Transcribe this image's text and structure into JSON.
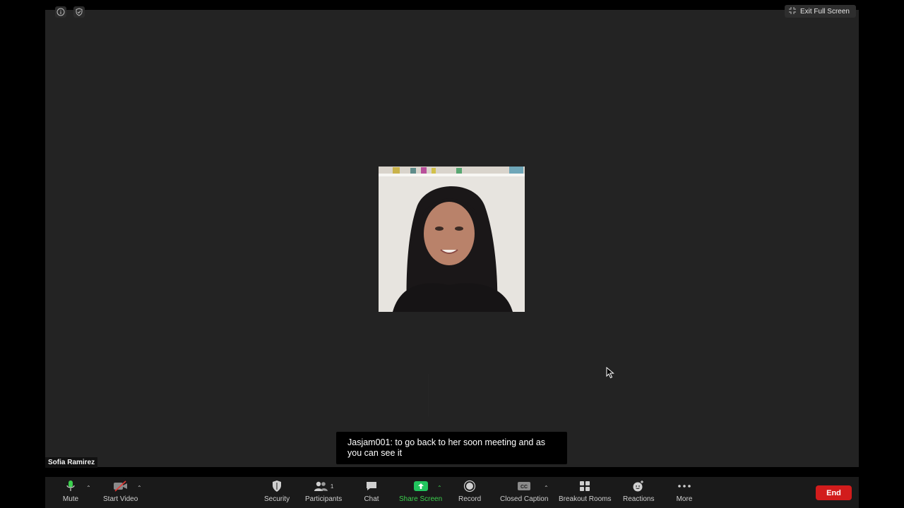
{
  "top": {
    "exit_fullscreen_label": "Exit Full Screen"
  },
  "participant": {
    "name": "Sofia Ramirez"
  },
  "caption": {
    "text": "Jasjam001: to go back to her soon meeting and as you can see it"
  },
  "toolbar": {
    "mute": "Mute",
    "start_video": "Start Video",
    "security": "Security",
    "participants": "Participants",
    "participants_count": "1",
    "chat": "Chat",
    "share_screen": "Share Screen",
    "record": "Record",
    "closed_caption": "Closed Caption",
    "breakout_rooms": "Breakout Rooms",
    "reactions": "Reactions",
    "more": "More",
    "end": "End"
  },
  "icons": [
    "info-icon",
    "shield-check-icon",
    "exit-fullscreen-icon",
    "microphone-icon",
    "video-off-icon",
    "security-shield-icon",
    "participants-icon",
    "chat-icon",
    "share-screen-icon",
    "record-icon",
    "cc-icon",
    "breakout-rooms-icon",
    "reactions-icon",
    "more-icon",
    "pointer-cursor-icon"
  ],
  "colors": {
    "share_green": "#22c55e",
    "end_red": "#d21c1c",
    "mic_green": "#3ccf4e",
    "stage_bg": "#232323"
  }
}
